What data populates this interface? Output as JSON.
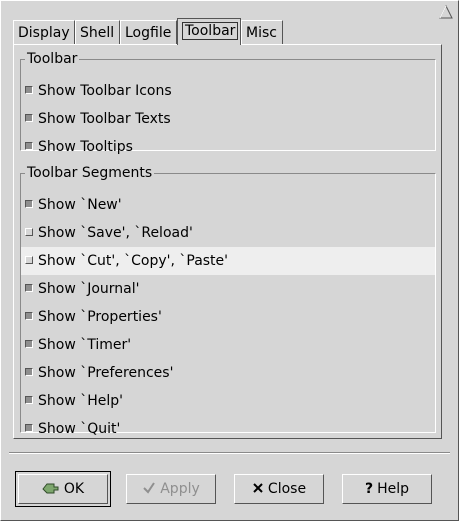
{
  "tabs": [
    {
      "label": "Display",
      "active": false
    },
    {
      "label": "Shell",
      "active": false
    },
    {
      "label": "Logfile",
      "active": false
    },
    {
      "label": "Toolbar",
      "active": true
    },
    {
      "label": "Misc",
      "active": false
    }
  ],
  "toolbar_group": {
    "title": "Toolbar",
    "items": [
      {
        "label": "Show Toolbar Icons",
        "checked": true
      },
      {
        "label": "Show Toolbar Texts",
        "checked": true
      },
      {
        "label": "Show Tooltips",
        "checked": true
      }
    ]
  },
  "segments_group": {
    "title": "Toolbar Segments",
    "items": [
      {
        "label": "Show `New'",
        "checked": true
      },
      {
        "label": "Show `Save', `Reload'",
        "checked": false
      },
      {
        "label": "Show `Cut', `Copy', `Paste'",
        "checked": false,
        "highlighted": true
      },
      {
        "label": "Show `Journal'",
        "checked": true
      },
      {
        "label": "Show `Properties'",
        "checked": true
      },
      {
        "label": "Show `Timer'",
        "checked": true
      },
      {
        "label": "Show `Preferences'",
        "checked": true
      },
      {
        "label": "Show `Help'",
        "checked": true
      },
      {
        "label": "Show `Quit'",
        "checked": true
      }
    ]
  },
  "buttons": {
    "ok": {
      "label": "OK",
      "icon": "ok-hand-icon",
      "enabled": true
    },
    "apply": {
      "label": "Apply",
      "icon": "checkmark-icon",
      "enabled": false
    },
    "close": {
      "label": "Close",
      "icon": "close-x-icon",
      "enabled": true
    },
    "help": {
      "label": "Help",
      "icon": "question-mark-icon",
      "enabled": true
    }
  },
  "colors": {
    "background": "#d6d6d6",
    "highlight_row": "#eeeeee",
    "disabled_text": "#8f8f8f"
  }
}
